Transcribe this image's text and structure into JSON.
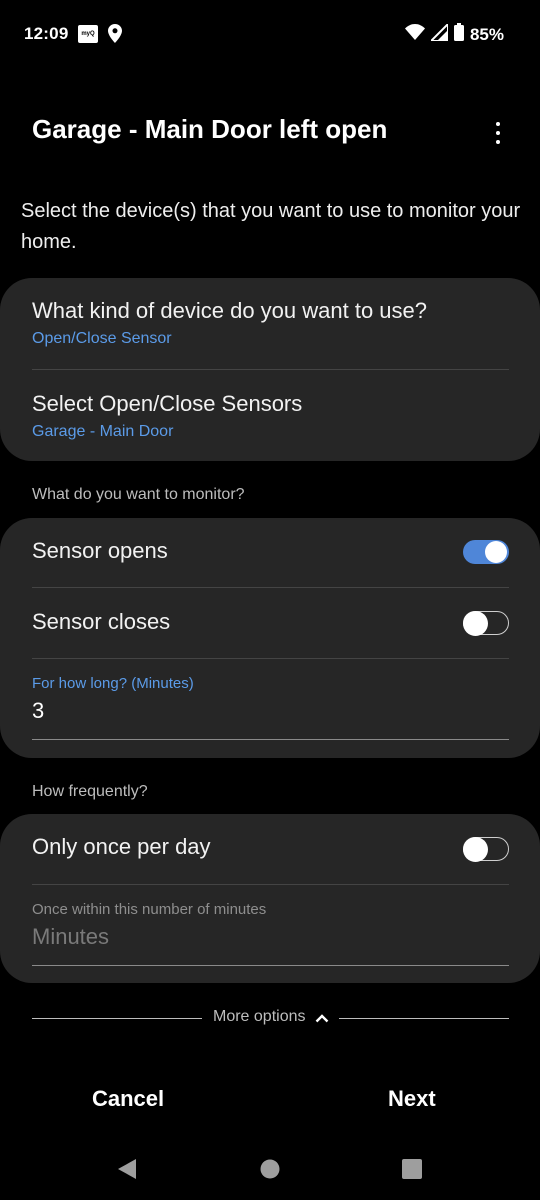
{
  "status_bar": {
    "time": "12:09",
    "app_badge": "myQ",
    "battery": "85%"
  },
  "header": {
    "title": "Garage - Main Door left open"
  },
  "intro": "Select the device(s) that you want to use to monitor your home.",
  "device_card": {
    "kind_label": "What kind of device do you want to use?",
    "kind_value": "Open/Close Sensor",
    "sensors_label": "Select Open/Close Sensors",
    "sensors_value": "Garage - Main Door"
  },
  "monitor_section": {
    "heading": "What do you want to monitor?",
    "opens_label": "Sensor opens",
    "opens_on": true,
    "closes_label": "Sensor closes",
    "closes_on": false,
    "duration_label": "For how long? (Minutes)",
    "duration_value": "3"
  },
  "frequency_section": {
    "heading": "How frequently?",
    "once_label": "Only once per day",
    "once_on": false,
    "minutes_label": "Once within this number of minutes",
    "minutes_placeholder": "Minutes"
  },
  "more_options": "More options",
  "actions": {
    "cancel": "Cancel",
    "next": "Next"
  },
  "colors": {
    "accent": "#5b9be8",
    "toggle_on": "#4f86d8",
    "card_bg": "#262626"
  }
}
